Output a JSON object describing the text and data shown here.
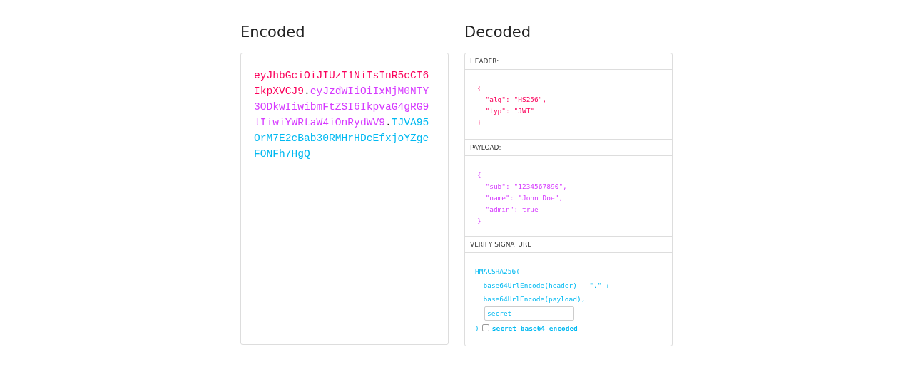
{
  "encoded": {
    "title": "Encoded",
    "segments": [
      {
        "kind": "header",
        "text": "eyJhbGciOiJIUzI1NiIsInR5cCI6IkpXVCJ9"
      },
      {
        "kind": "dot",
        "text": "."
      },
      {
        "kind": "payload",
        "text": "eyJzdWIiOiIxMjM0NTY3ODkwIiwibmFtZSI6IkpvaG4gRG9lIiwiYWRtaW4iOnRydWV9"
      },
      {
        "kind": "dot",
        "text": "."
      },
      {
        "kind": "signature",
        "text": "TJVA95OrM7E2cBab30RMHrHDcEfxjoYZgeFONFh7HgQ"
      }
    ]
  },
  "decoded": {
    "title": "Decoded",
    "sections": [
      {
        "kind": "header",
        "label": "HEADER:",
        "lines": [
          "{",
          "  \"alg\": \"HS256\",",
          "  \"typ\": \"JWT\"",
          "}"
        ]
      },
      {
        "kind": "payload",
        "label": "PAYLOAD:",
        "lines": [
          "{",
          "  \"sub\": \"1234567890\",",
          "  \"name\": \"John Doe\",",
          "  \"admin\": true",
          "}"
        ]
      },
      {
        "kind": "signature",
        "label": "VERIFY SIGNATURE",
        "lines": [
          "HMACSHA256(",
          "  base64UrlEncode(header) + \".\" +",
          "  base64UrlEncode(payload),"
        ],
        "secret": {
          "value": "secret"
        },
        "closing": ")",
        "checkbox": {
          "label": "secret base64 encoded",
          "checked": false
        }
      }
    ]
  }
}
